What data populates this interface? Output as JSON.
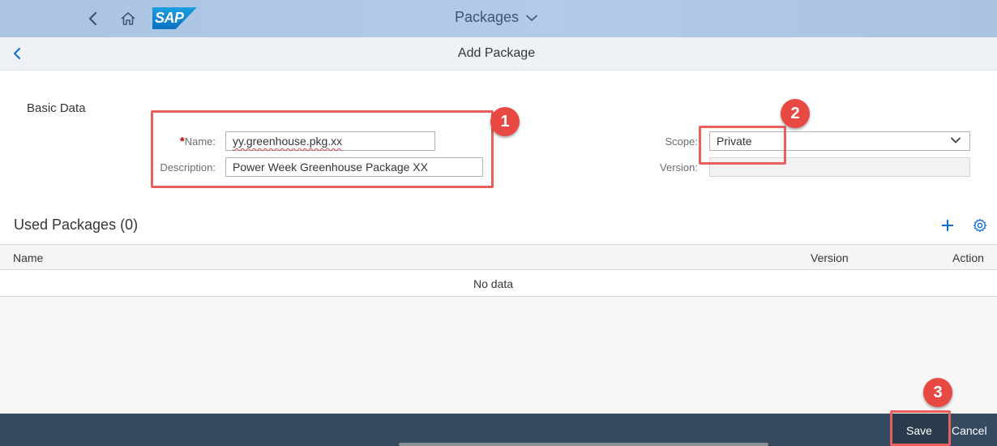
{
  "shell": {
    "app_title": "Packages",
    "logo_text": "SAP"
  },
  "page": {
    "title": "Add Package"
  },
  "form": {
    "section_title": "Basic Data",
    "required_marker": "*",
    "name_label": "Name:",
    "name_value": "yy.greenhouse.pkg.xx",
    "description_label": "Description:",
    "description_value": "Power Week Greenhouse Package XX",
    "scope_label": "Scope:",
    "scope_value": "Private",
    "version_label": "Version:",
    "version_value": ""
  },
  "used_packages": {
    "title": "Used Packages (0)",
    "columns": [
      "Name",
      "Version",
      "Action"
    ],
    "no_data": "No data"
  },
  "footer": {
    "save_label": "Save",
    "cancel_label": "Cancel"
  },
  "annotations": [
    "1",
    "2",
    "3"
  ],
  "colors": {
    "shell": "#aac4e2",
    "footer": "#354a5f",
    "highlight": "#e8605d",
    "marker": "#e84a43",
    "accent": "#0a6ed1"
  },
  "icons": [
    "back-icon",
    "home-icon",
    "chevron-down-icon",
    "nav-back-icon",
    "add-icon",
    "settings-icon"
  ]
}
